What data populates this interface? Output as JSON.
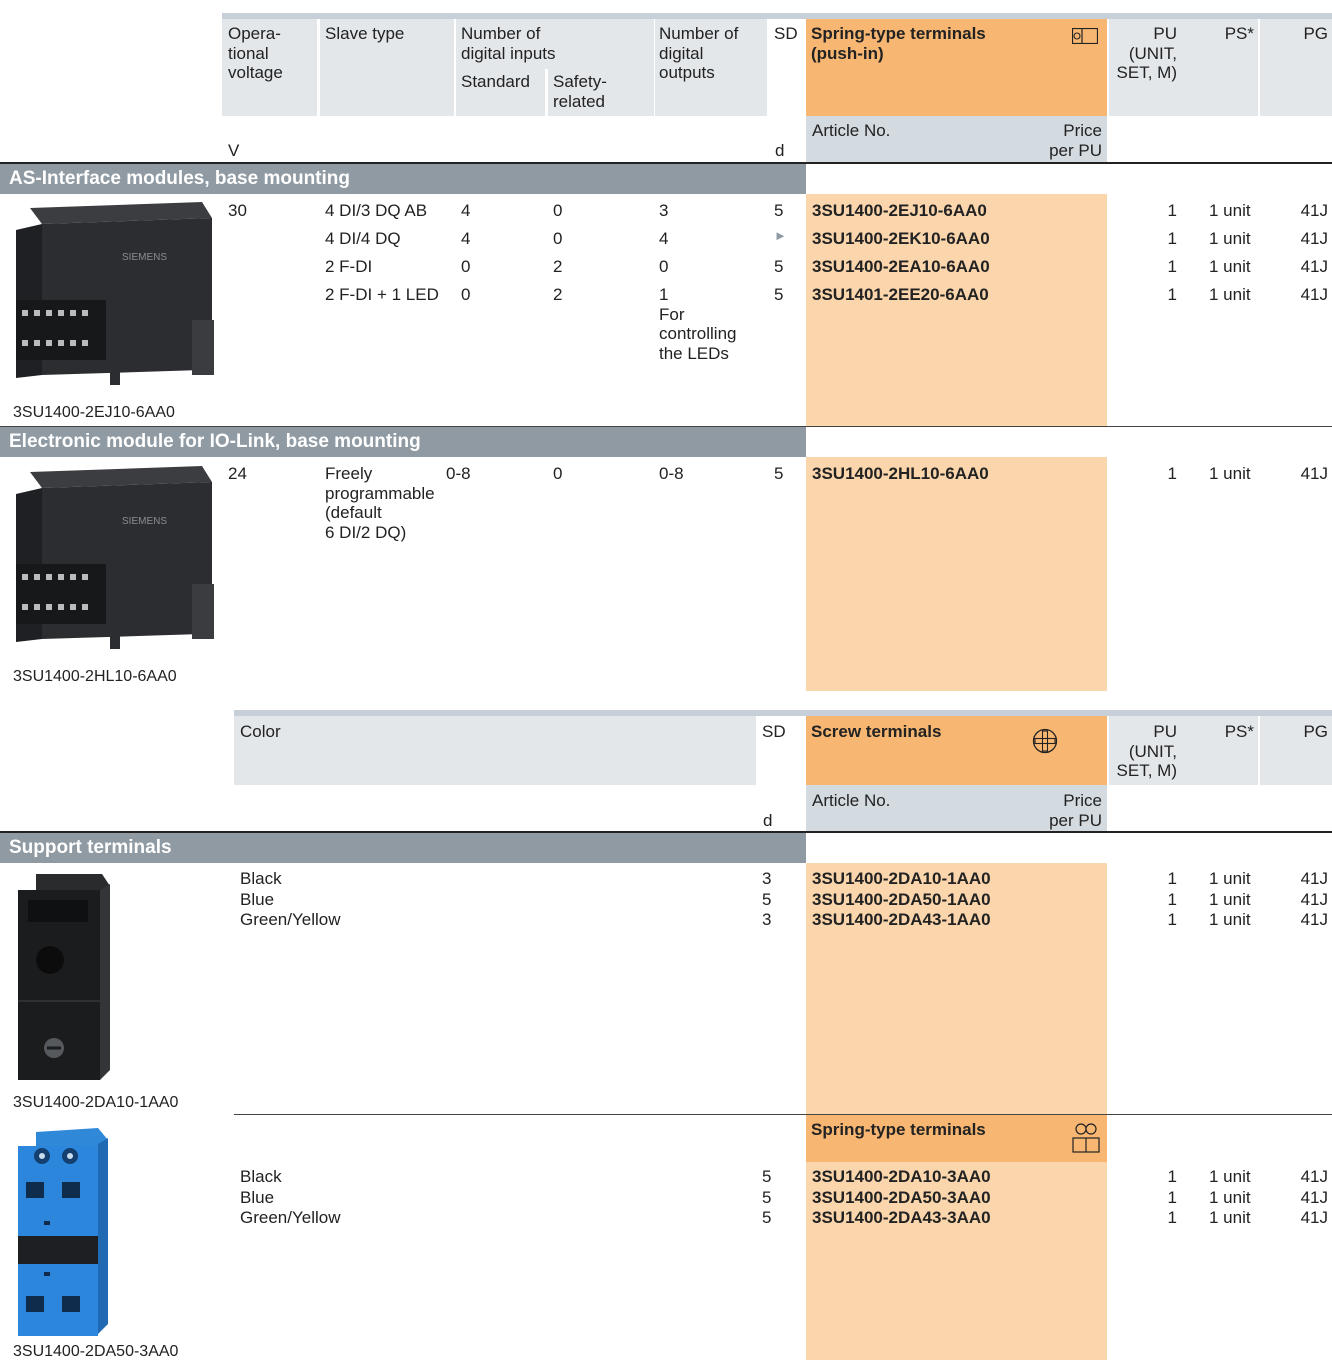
{
  "table1": {
    "header": {
      "voltage": "Opera-\ntional\nvoltage",
      "slave_type": "Slave type",
      "num_inputs": "Number of\ndigital inputs",
      "standard": "Standard",
      "safety": "Safety-\nrelated",
      "num_outputs": "Number of\ndigital\noutputs",
      "sd": "SD",
      "terminals": "Spring-type terminals\n(push-in)",
      "pu": "PU\n(UNIT,\nSET, M)",
      "ps": "PS*",
      "pg": "PG",
      "article": "Article No.",
      "price": "Price\nper PU",
      "unit_v": "V",
      "unit_d": "d"
    },
    "sections": [
      {
        "title": "AS-Interface modules, base mounting",
        "image_caption": "3SU1400-2EJ10-6AA0",
        "rows": [
          {
            "voltage": "30",
            "slave": "4 DI/3 DQ AB",
            "std": "4",
            "safety": "0",
            "outputs": "3",
            "sd": "5",
            "article": "3SU1400-2EJ10-6AA0",
            "pu": "1",
            "ps": "1 unit",
            "pg": "41J"
          },
          {
            "voltage": "",
            "slave": "4 DI/4 DQ",
            "std": "4",
            "safety": "0",
            "outputs": "4",
            "sd": "►",
            "article": "3SU1400-2EK10-6AA0",
            "pu": "1",
            "ps": "1 unit",
            "pg": "41J"
          },
          {
            "voltage": "",
            "slave": "2 F-DI",
            "std": "0",
            "safety": "2",
            "outputs": "0",
            "sd": "5",
            "article": "3SU1400-2EA10-6AA0",
            "pu": "1",
            "ps": "1 unit",
            "pg": "41J"
          },
          {
            "voltage": "",
            "slave": "2 F-DI + 1 LED",
            "std": "0",
            "safety": "2",
            "outputs": "1\nFor\ncontrolling\nthe LEDs",
            "sd": "5",
            "article": "3SU1401-2EE20-6AA0",
            "pu": "1",
            "ps": "1 unit",
            "pg": "41J"
          }
        ]
      },
      {
        "title": "Electronic module for IO-Link, base mounting",
        "image_caption": "3SU1400-2HL10-6AA0",
        "rows": [
          {
            "voltage": "24",
            "slave": "Freely\nprogrammable\n(default\n6 DI/2 DQ)",
            "std": "0-8",
            "safety": "0",
            "outputs": "0-8",
            "sd": "5",
            "article": "3SU1400-2HL10-6AA0",
            "pu": "1",
            "ps": "1 unit",
            "pg": "41J"
          }
        ]
      }
    ]
  },
  "table2": {
    "header": {
      "color": "Color",
      "sd": "SD",
      "terminals": "Screw terminals",
      "pu": "PU\n(UNIT,\nSET, M)",
      "ps": "PS*",
      "pg": "PG",
      "article": "Article No.",
      "price": "Price\nper PU",
      "unit_d": "d"
    },
    "section_title": "Support terminals",
    "screw": {
      "image_caption": "3SU1400-2DA10-1AA0",
      "colors": "Black\nBlue\nGreen/Yellow",
      "sd": "3\n5\n3",
      "articles": "3SU1400-2DA10-1AA0\n3SU1400-2DA50-1AA0\n3SU1400-2DA43-1AA0",
      "pu": "1\n1\n1",
      "ps": "1 unit\n1 unit\n1 unit",
      "pg": "41J\n41J\n41J"
    },
    "spring": {
      "label": "Spring-type terminals",
      "image_caption": "3SU1400-2DA50-3AA0",
      "colors": "Black\nBlue\nGreen/Yellow",
      "sd": "5\n5\n5",
      "articles": "3SU1400-2DA10-3AA0\n3SU1400-2DA50-3AA0\n3SU1400-2DA43-3AA0",
      "pu": "1\n1\n1",
      "ps": "1 unit\n1 unit\n1 unit",
      "pg": "41J\n41J\n41J"
    }
  },
  "icons": {
    "push_in": "push-in-terminal-icon",
    "screw": "screw-terminal-icon",
    "spring": "spring-terminal-icon"
  },
  "colors": {
    "orange_header": "#f7b772",
    "orange_body": "#fbd6ad",
    "section_bar": "#8f9aa3",
    "header_gray": "#e3e7ea"
  }
}
